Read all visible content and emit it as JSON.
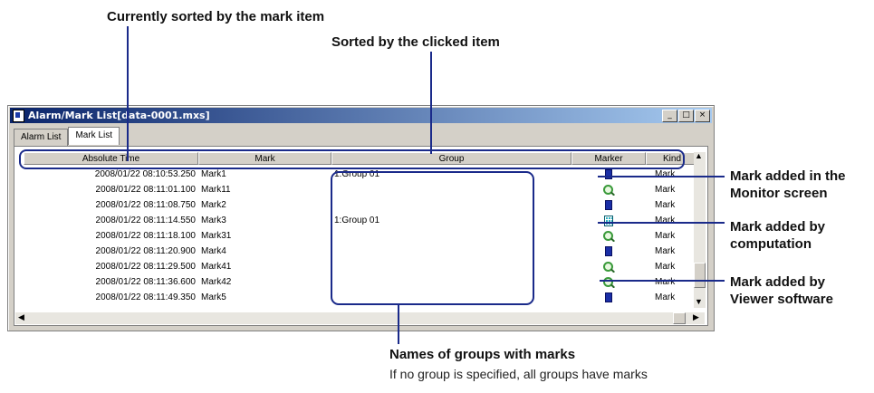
{
  "callouts": {
    "sorted_mark": "Currently sorted by the mark item",
    "sorted_clicked": "Sorted by the clicked item",
    "monitor_line1": "Mark added in the",
    "monitor_line2": "Monitor screen",
    "computation_line1": "Mark added by",
    "computation_line2": "computation",
    "viewer_line1": "Mark added by",
    "viewer_line2": "Viewer software",
    "groups_title": "Names of groups with marks",
    "groups_note": "If no group is specified, all groups have marks"
  },
  "window": {
    "title": "Alarm/Mark List[data-0001.mxs]",
    "minimize": "_",
    "maximize": "□",
    "close": "×"
  },
  "tabs": [
    "Alarm List",
    "Mark List"
  ],
  "columns": {
    "time": "Absolute Time",
    "mark": "Mark",
    "group": "Group",
    "marker": "Marker",
    "kind": "Kind"
  },
  "rows": [
    {
      "time": "2008/01/22 08:10:53.250",
      "mark": "Mark1",
      "group": "1:Group 01",
      "marker_icon": "note-icon",
      "kind": "Mark"
    },
    {
      "time": "2008/01/22 08:11:01.100",
      "mark": "Mark11",
      "group": "",
      "marker_icon": "magnifier-icon",
      "kind": "Mark"
    },
    {
      "time": "2008/01/22 08:11:08.750",
      "mark": "Mark2",
      "group": "",
      "marker_icon": "note-icon",
      "kind": "Mark"
    },
    {
      "time": "2008/01/22 08:11:14.550",
      "mark": "Mark3",
      "group": "1:Group 01",
      "marker_icon": "calculator-icon",
      "kind": "Mark"
    },
    {
      "time": "2008/01/22 08:11:18.100",
      "mark": "Mark31",
      "group": "",
      "marker_icon": "magnifier-icon",
      "kind": "Mark"
    },
    {
      "time": "2008/01/22 08:11:20.900",
      "mark": "Mark4",
      "group": "",
      "marker_icon": "note-icon",
      "kind": "Mark"
    },
    {
      "time": "2008/01/22 08:11:29.500",
      "mark": "Mark41",
      "group": "",
      "marker_icon": "magnifier-icon",
      "kind": "Mark"
    },
    {
      "time": "2008/01/22 08:11:36.600",
      "mark": "Mark42",
      "group": "",
      "marker_icon": "magnifier-icon",
      "kind": "Mark"
    },
    {
      "time": "2008/01/22 08:11:49.350",
      "mark": "Mark5",
      "group": "",
      "marker_icon": "note-icon",
      "kind": "Mark"
    }
  ],
  "colors": {
    "callout_line": "#1a2a8a",
    "titlebar": "#0a246a"
  }
}
